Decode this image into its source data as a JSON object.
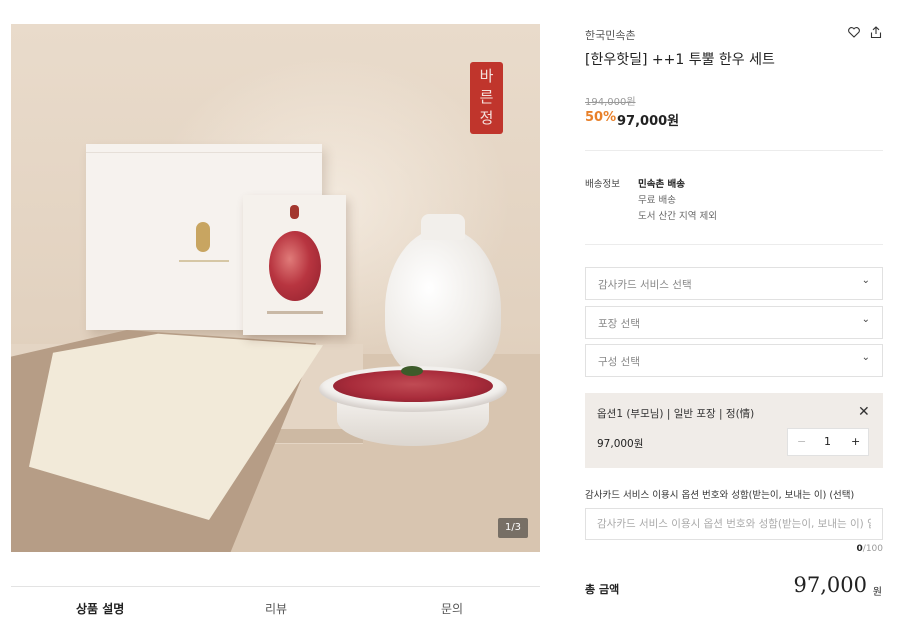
{
  "gallery": {
    "counter": "1/3",
    "seal_text": "바른정"
  },
  "tabs": [
    {
      "label": "상품 설명"
    },
    {
      "label": "리뷰"
    },
    {
      "label": "문의"
    }
  ],
  "product": {
    "brand": "한국민속촌",
    "title": "[한우핫딜] ++1 투뿔 한우 세트",
    "original_price": "194,000원",
    "discount": "50%",
    "sale_price": "97,000원"
  },
  "shipping": {
    "label": "배송정보",
    "lines": [
      "민속촌 배송",
      "무료 배송",
      "도서 산간 지역 제외"
    ]
  },
  "selects": [
    {
      "text": "감사카드 서비스 선택"
    },
    {
      "text": "포장 선택"
    },
    {
      "text": "구성 선택"
    }
  ],
  "selected_option": {
    "name": "옵션1 (부모님) | 일반 포장 | 정(情)",
    "price": "97,000원",
    "quantity": "1"
  },
  "message": {
    "label": "감사카드 서비스 이용시 옵션 번호와 성함(받는이, 보내는 이) (선택)",
    "placeholder": "감사카드 서비스 이용시 옵션 번호와 성함(받는이, 보내는 이) 입력",
    "count": "0",
    "max": "/100"
  },
  "total": {
    "label": "총 금액",
    "amount": "97,000",
    "unit": "원"
  },
  "icons": {
    "wishlist": "heart-icon",
    "share": "share-icon"
  },
  "colors": {
    "discount": "#e8802a",
    "seal": "#c0352c",
    "option_bg": "#f0ece8"
  }
}
